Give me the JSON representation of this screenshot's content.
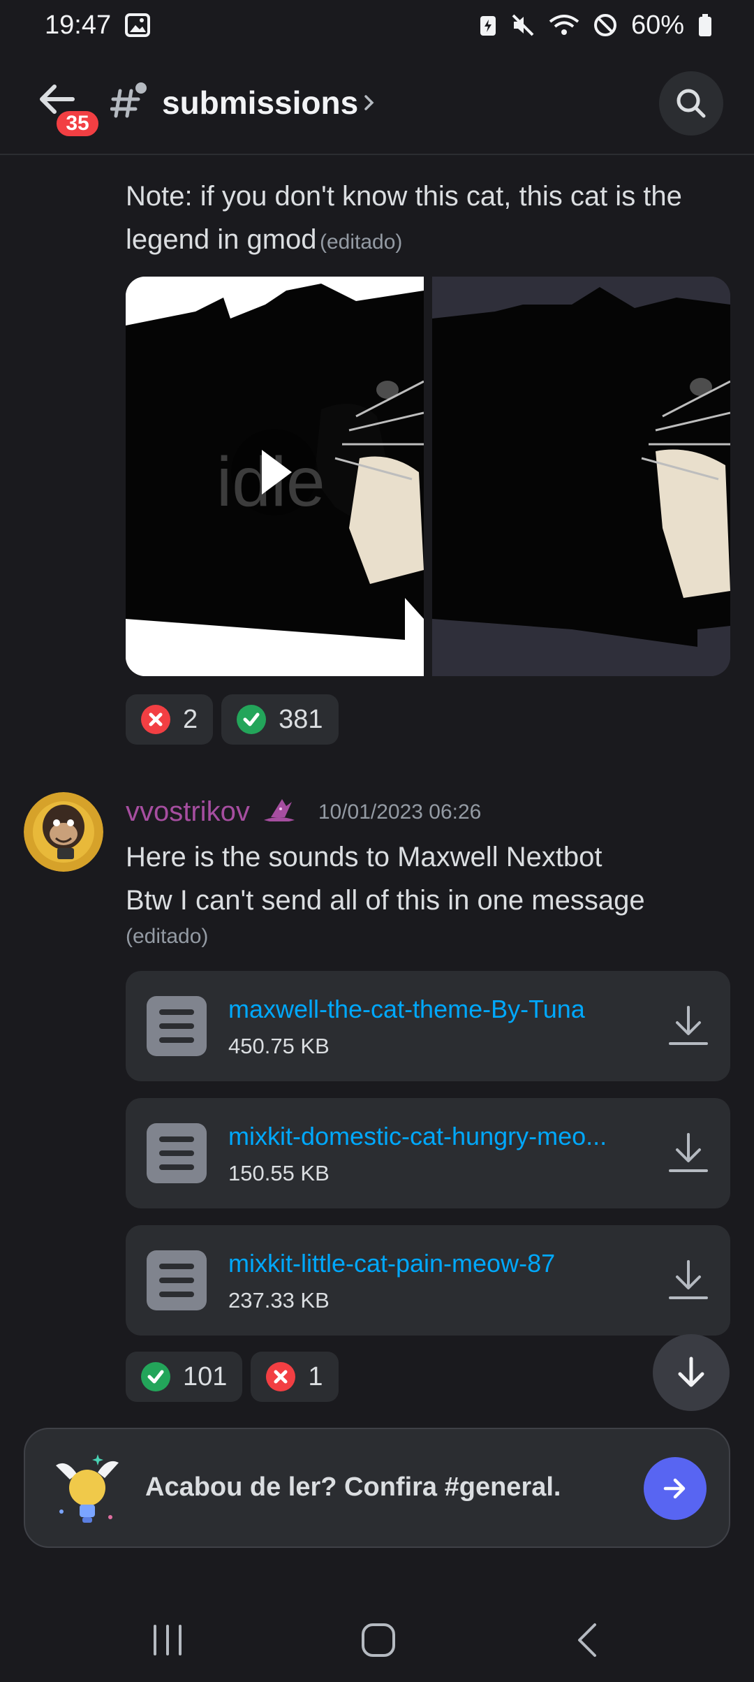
{
  "status_bar": {
    "time": "19:47",
    "battery": "60%"
  },
  "header": {
    "unread_count": "35",
    "channel_name": "submissions"
  },
  "messages": [
    {
      "text": "Note: if you don't know this cat, this cat is the legend in gmod",
      "edited": "(editado)",
      "media": {
        "overlay_text": "idle"
      },
      "reactions": [
        {
          "type": "x",
          "count": "2"
        },
        {
          "type": "check",
          "count": "381"
        }
      ]
    },
    {
      "username": "vvostrikov",
      "timestamp": "10/01/2023 06:26",
      "lines": [
        "Here is the sounds to Maxwell Nextbot",
        "Btw I can't send all of this in one message"
      ],
      "edited": "(editado)",
      "attachments": [
        {
          "name": "maxwell-the-cat-theme-By-Tuna",
          "size": "450.75 KB"
        },
        {
          "name": "mixkit-domestic-cat-hungry-meo...",
          "size": "150.55 KB"
        },
        {
          "name": "mixkit-little-cat-pain-meow-87",
          "size": "237.33 KB"
        }
      ],
      "reactions": [
        {
          "type": "check",
          "count": "101"
        },
        {
          "type": "x",
          "count": "1"
        }
      ]
    }
  ],
  "prompt": {
    "text": "Acabou de ler? Confira #general."
  },
  "colors": {
    "background": "#1a1a1e",
    "link": "#00a8fc",
    "username": "#a64ea0",
    "blurple": "#5865f2",
    "danger": "#f23f43",
    "success": "#23a55a"
  }
}
